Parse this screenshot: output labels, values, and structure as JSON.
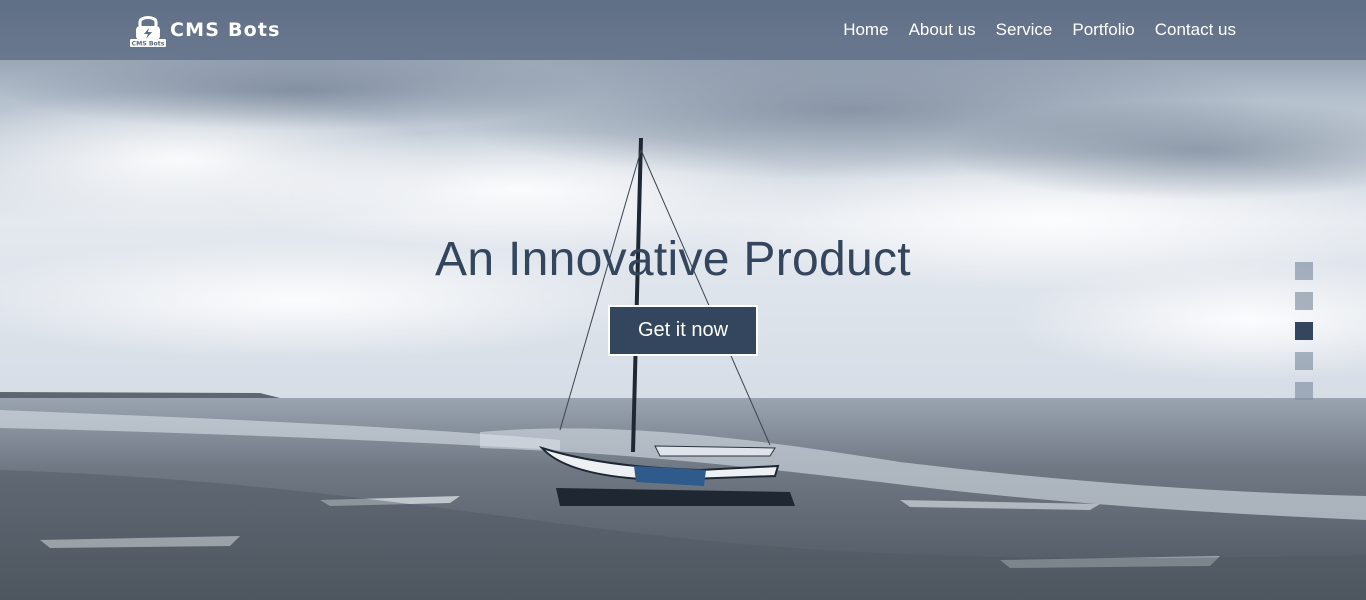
{
  "brand": {
    "name": "CMS Bots",
    "badge_text": "CMS Bots",
    "logo_icon": "padlock-bolt-icon"
  },
  "nav": {
    "items": [
      {
        "label": "Home"
      },
      {
        "label": "About us"
      },
      {
        "label": "Service"
      },
      {
        "label": "Portfolio"
      },
      {
        "label": "Contact us"
      }
    ]
  },
  "hero": {
    "headline": "An Innovative Product",
    "cta_label": "Get it now",
    "slides": {
      "count": 5,
      "active_index": 3
    }
  },
  "colors": {
    "accent": "#33465d",
    "nav_background": "#5c6c84",
    "text_on_dark": "#ffffff"
  }
}
